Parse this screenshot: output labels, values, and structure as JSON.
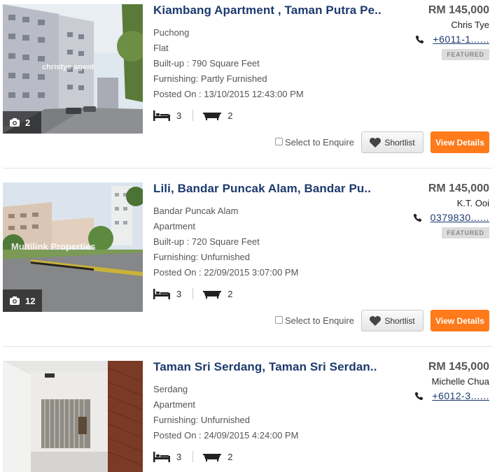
{
  "listings": [
    {
      "title": "Kiambang Apartment , Taman Putra Pe..",
      "price": "RM 145,000",
      "agent": "Chris Tye",
      "phone": "+6011-1......",
      "featured": "FEATURED",
      "photo_count": "2",
      "watermark": "christye agent",
      "location": "Puchong",
      "property_type": "Flat",
      "built_up": "Built-up : 790 Square Feet",
      "furnishing": "Furnishing: Partly Furnished",
      "posted_on": "Posted On : 13/10/2015 12:43:00 PM",
      "bedrooms": "3",
      "bathrooms": "2",
      "enquire_label": "Select to Enquire",
      "shortlist_label": "Shortlist",
      "view_label": "View Details"
    },
    {
      "title": "Lili, Bandar Puncak Alam, Bandar Pu..",
      "price": "RM 145,000",
      "agent": "K.T. Ooi",
      "phone": "0379830......",
      "featured": "FEATURED",
      "photo_count": "12",
      "watermark": "Multilink Properties",
      "location": "Bandar Puncak Alam",
      "property_type": "Apartment",
      "built_up": "Built-up : 720 Square Feet",
      "furnishing": "Furnishing: Unfurnished",
      "posted_on": "Posted On : 22/09/2015 3:07:00 PM",
      "bedrooms": "3",
      "bathrooms": "2",
      "enquire_label": "Select to Enquire",
      "shortlist_label": "Shortlist",
      "view_label": "View Details"
    },
    {
      "title": "Taman Sri Serdang, Taman Sri Serdan..",
      "price": "RM 145,000",
      "agent": "Michelle Chua",
      "phone": "+6012-3......",
      "location": "Serdang",
      "property_type": "Apartment",
      "furnishing": "Furnishing: Unfurnished",
      "posted_on": "Posted On : 24/09/2015 4:24:00 PM",
      "bedrooms": "3",
      "bathrooms": "2"
    }
  ],
  "icons": {
    "camera": "camera-icon",
    "phone": "phone-icon",
    "bed": "bed-icon",
    "bath": "bathtub-icon",
    "heart": "heart-icon"
  },
  "colors": {
    "title": "#1d3a6e",
    "view_button": "#ff7a1a",
    "featured_badge": "#dcdcdc"
  }
}
